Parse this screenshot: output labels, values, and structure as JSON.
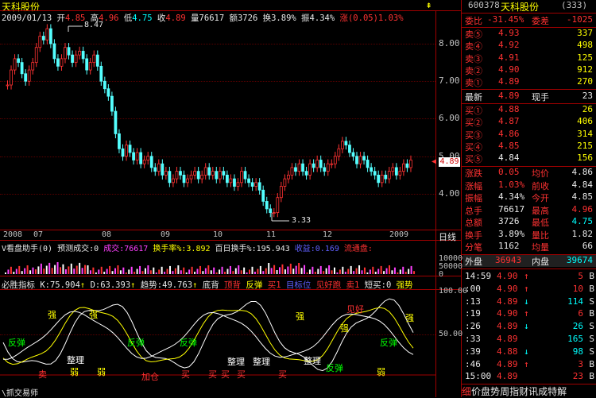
{
  "title": "天科股份",
  "header_bar": {
    "date": "2009/01/13",
    "open_label": "开",
    "open": "4.85",
    "high_label": "高",
    "high": "4.96",
    "low_label": "低",
    "low": "4.75",
    "close_label": "收",
    "close": "4.89",
    "vol_label": "量",
    "vol": "76617",
    "amt_label": "额",
    "amt": "3726",
    "turn_label": "换",
    "turn": "3.89%",
    "amp_label": "振",
    "amp": "4.34%",
    "chg_label": "涨",
    "chg": "(0.05)",
    "chg_pct": "1.03%"
  },
  "price_axis": [
    "8.00",
    "7.00",
    "6.00",
    "5.00",
    "4.00"
  ],
  "current_price": "4.89",
  "max_label": "8.47",
  "min_label": "3.33",
  "date_axis": [
    "2008",
    "07",
    "08",
    "09",
    "10",
    "11",
    "12",
    "2009"
  ],
  "period": "日线",
  "volume_bar": {
    "indicator": "V看盘助手(0)",
    "predict": "预测成交:0",
    "vol_label": "成交:76617",
    "turn_label": "换手率%:3.892",
    "hundred_label": "百日换手%:195.943",
    "profit_label": "收益:0.169",
    "float_label": "流通盘:",
    "axis": [
      "100000",
      "50000",
      "0"
    ]
  },
  "indicator_bar": {
    "name": "必胜指标",
    "k": "K:75.904",
    "d": "D:63.393",
    "trend": "趋势:49.763",
    "bottom_div": "底背",
    "top_div": "顶背",
    "rebound": "反弹",
    "buy1": "买1",
    "target": "目标位",
    "see_good": "见好跑",
    "sell1": "卖1",
    "short_buy": "短买:0",
    "strong": "强势",
    "axis": [
      "100.00",
      "50.00"
    ]
  },
  "osc_labels": [
    "强",
    "强",
    "反弹",
    "整理",
    "弱",
    "弱",
    "反弹",
    "反弹",
    "整理",
    "整理",
    "强",
    "整理",
    "反弹",
    "见好",
    "强",
    "反弹",
    "弱",
    "强",
    "卖",
    "加仓",
    "买",
    "买",
    "买",
    "买",
    "买"
  ],
  "footer_left": "抓交易师",
  "quote": {
    "code": "600378",
    "name": "天科股份",
    "num": "(333)",
    "weibi_label": "委比",
    "weibi": "-31.45%",
    "weicha_label": "委差",
    "weicha": "-1025",
    "sells": [
      {
        "label": "卖⑤",
        "price": "4.93",
        "vol": "337"
      },
      {
        "label": "卖④",
        "price": "4.92",
        "vol": "498"
      },
      {
        "label": "卖③",
        "price": "4.91",
        "vol": "125"
      },
      {
        "label": "卖②",
        "price": "4.90",
        "vol": "912"
      },
      {
        "label": "卖①",
        "price": "4.89",
        "vol": "270"
      }
    ],
    "latest_label": "最新",
    "latest": "4.89",
    "cur_hand_label": "现手",
    "cur_hand": "23",
    "buys": [
      {
        "label": "买①",
        "price": "4.88",
        "vol": "26"
      },
      {
        "label": "买②",
        "price": "4.87",
        "vol": "406"
      },
      {
        "label": "买③",
        "price": "4.86",
        "vol": "314"
      },
      {
        "label": "买④",
        "price": "4.85",
        "vol": "215"
      },
      {
        "label": "买⑤",
        "price": "4.84",
        "vol": "156"
      }
    ],
    "stats": [
      {
        "l1": "涨跌",
        "v1": "0.05",
        "l2": "均价",
        "v2": "4.86"
      },
      {
        "l1": "涨幅",
        "v1": "1.03%",
        "l2": "前收",
        "v2": "4.84"
      },
      {
        "l1": "振幅",
        "v1": "4.34%",
        "l2": "今开",
        "v2": "4.85"
      },
      {
        "l1": "总手",
        "v1": "76617",
        "l2": "最高",
        "v2": "4.96"
      },
      {
        "l1": "总额",
        "v1": "3726",
        "l2": "最低",
        "v2": "4.75"
      },
      {
        "l1": "换手",
        "v1": "3.89%",
        "l2": "量比",
        "v2": "1.82"
      },
      {
        "l1": "分笔",
        "v1": "1162",
        "l2": "均量",
        "v2": "66"
      }
    ],
    "outer_label": "外盘",
    "outer": "36943",
    "inner_label": "内盘",
    "inner": "39674",
    "ticks": [
      {
        "t": "14:59",
        "p": "4.90",
        "a": "↑",
        "v": "5",
        "s": "B"
      },
      {
        "t": ":00",
        "p": "4.90",
        "a": "↑",
        "v": "10",
        "s": "B"
      },
      {
        "t": ":13",
        "p": "4.89",
        "a": "↓",
        "v": "114",
        "s": "S"
      },
      {
        "t": ":19",
        "p": "4.90",
        "a": "↑",
        "v": "6",
        "s": "B"
      },
      {
        "t": ":26",
        "p": "4.89",
        "a": "↓",
        "v": "26",
        "s": "S"
      },
      {
        "t": ":33",
        "p": "4.89",
        "a": "",
        "v": "165",
        "s": "S"
      },
      {
        "t": ":39",
        "p": "4.88",
        "a": "↓",
        "v": "98",
        "s": "S"
      },
      {
        "t": ":46",
        "p": "4.89",
        "a": "↑",
        "v": "3",
        "s": "B"
      },
      {
        "t": "15:00",
        "p": "4.89",
        "a": "",
        "v": "23",
        "s": "B"
      }
    ],
    "bottom_tabs": [
      "细",
      "价",
      "盘",
      "势",
      "周",
      "指",
      "财",
      "讯",
      "成",
      "特",
      "解"
    ]
  },
  "colors": {
    "up": "#ff3232",
    "down": "#00e0e0",
    "grid": "#a00000"
  }
}
